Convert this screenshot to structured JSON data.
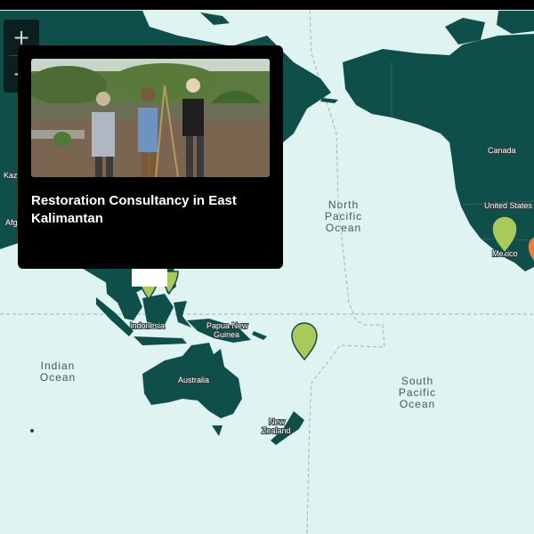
{
  "map": {
    "colors": {
      "ocean": "#dff3f1",
      "land": "#0f4f49",
      "marker_green": "#a9c95b",
      "marker_orange": "#f07a3c"
    },
    "ocean_labels": {
      "north_pacific": [
        "North",
        "Pacific",
        "Ocean"
      ],
      "south_pacific": [
        "South",
        "Pacific",
        "Ocean"
      ],
      "indian": [
        "Indian",
        "Ocean"
      ]
    },
    "country_labels": {
      "canada": "Canada",
      "united_states": "United States",
      "mexico": "Mexico",
      "indonesia": "Indonesia",
      "papua_line1": "Papua New",
      "papua_line2": "Guinea",
      "australia": "Australia",
      "nz_line1": "New",
      "nz_line2": "Zealand",
      "kaz_partial": "Kaz",
      "afg_partial": "Afg"
    },
    "markers": [
      {
        "name": "pacific-marker",
        "color": "green"
      },
      {
        "name": "mexico-marker",
        "color": "green"
      },
      {
        "name": "asia-marker-1",
        "color": "green"
      },
      {
        "name": "asia-marker-2",
        "color": "green"
      },
      {
        "name": "central-america-marker",
        "color": "orange"
      }
    ]
  },
  "zoom": {
    "in_label": "+",
    "out_label": "−"
  },
  "popup": {
    "title": "Restoration Consultancy in East Kalimantan",
    "photo_icon": "photo-of-field-team"
  }
}
